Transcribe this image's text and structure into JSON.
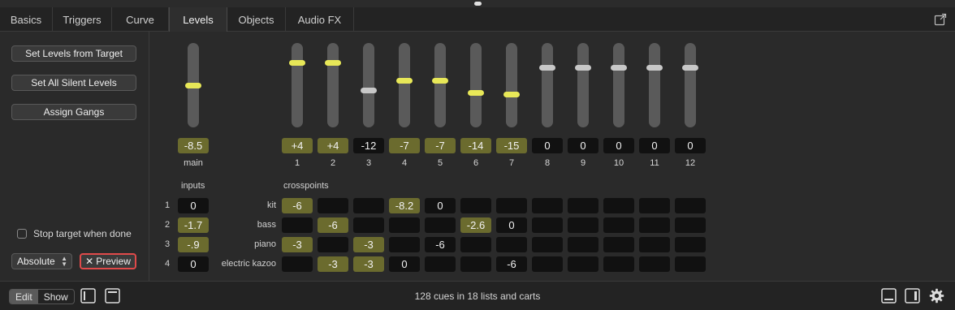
{
  "tabs": [
    {
      "label": "Basics",
      "active": false
    },
    {
      "label": "Triggers",
      "active": false
    },
    {
      "label": "Curve",
      "active": false
    },
    {
      "label": "Levels",
      "active": true
    },
    {
      "label": "Objects",
      "active": false
    },
    {
      "label": "Audio FX",
      "active": false
    }
  ],
  "left_panel": {
    "set_levels_from_target": "Set Levels from Target",
    "set_all_silent_levels": "Set All Silent Levels",
    "assign_gangs": "Assign Gangs",
    "stop_target_label": "Stop target when done",
    "stop_target_checked": false,
    "mode_select": "Absolute",
    "preview_label": "Preview",
    "preview_icon": "x-icon"
  },
  "faders": {
    "main": {
      "label": "main",
      "value": "-8.5",
      "active": true,
      "level": 0.5
    },
    "channels": [
      {
        "label": "1",
        "value": "+4",
        "active": true,
        "level": 0.78
      },
      {
        "label": "2",
        "value": "+4",
        "active": true,
        "level": 0.78
      },
      {
        "label": "3",
        "value": "-12",
        "active": false,
        "level": 0.43
      },
      {
        "label": "4",
        "value": "-7",
        "active": true,
        "level": 0.56
      },
      {
        "label": "5",
        "value": "-7",
        "active": true,
        "level": 0.56
      },
      {
        "label": "6",
        "value": "-14",
        "active": true,
        "level": 0.4
      },
      {
        "label": "7",
        "value": "-15",
        "active": true,
        "level": 0.38
      },
      {
        "label": "8",
        "value": "0",
        "active": false,
        "level": 0.72
      },
      {
        "label": "9",
        "value": "0",
        "active": false,
        "level": 0.72
      },
      {
        "label": "10",
        "value": "0",
        "active": false,
        "level": 0.72
      },
      {
        "label": "11",
        "value": "0",
        "active": false,
        "level": 0.72
      },
      {
        "label": "12",
        "value": "0",
        "active": false,
        "level": 0.72
      }
    ]
  },
  "grid": {
    "inputs_header": "inputs",
    "crosspoints_header": "crosspoints",
    "rows": [
      {
        "num": "1",
        "input": "0",
        "input_active": false,
        "name": "kit",
        "cells": [
          "-6",
          "",
          "",
          "-8.2",
          "0",
          "",
          "",
          "",
          "",
          "",
          "",
          ""
        ],
        "active": [
          true,
          false,
          false,
          true,
          false,
          false,
          false,
          false,
          false,
          false,
          false,
          false
        ]
      },
      {
        "num": "2",
        "input": "-1.7",
        "input_active": true,
        "name": "bass",
        "cells": [
          "",
          "-6",
          "",
          "",
          "",
          "-2.6",
          "0",
          "",
          "",
          "",
          "",
          ""
        ],
        "active": [
          false,
          true,
          false,
          false,
          false,
          true,
          false,
          false,
          false,
          false,
          false,
          false
        ]
      },
      {
        "num": "3",
        "input": "-.9",
        "input_active": true,
        "name": "piano",
        "cells": [
          "-3",
          "",
          "-3",
          "",
          "-6",
          "",
          "",
          "",
          "",
          "",
          "",
          ""
        ],
        "active": [
          true,
          false,
          true,
          false,
          false,
          false,
          false,
          false,
          false,
          false,
          false,
          false
        ]
      },
      {
        "num": "4",
        "input": "0",
        "input_active": false,
        "name": "electric kazoo",
        "cells": [
          "",
          "-3",
          "-3",
          "0",
          "",
          "",
          "-6",
          "",
          "",
          "",
          "",
          ""
        ],
        "active": [
          false,
          true,
          true,
          false,
          false,
          false,
          false,
          false,
          false,
          false,
          false,
          false
        ]
      }
    ]
  },
  "bottom_bar": {
    "edit_label": "Edit",
    "show_label": "Show",
    "status": "128 cues in 18 lists and carts"
  },
  "colors": {
    "active_fill": "#6b6b2e",
    "knob_active": "#e8e858",
    "preview_border": "#e04a4a"
  }
}
